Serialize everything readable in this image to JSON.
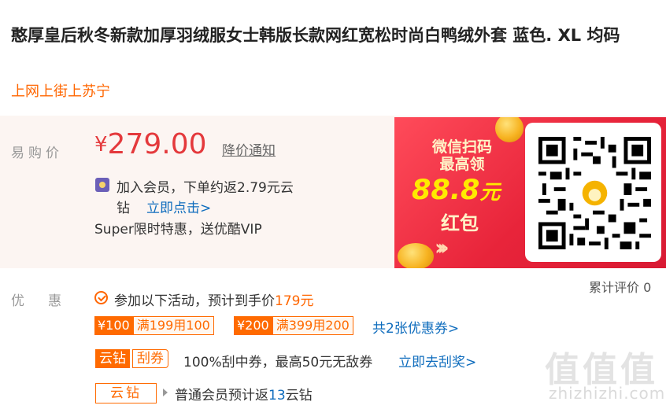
{
  "product": {
    "title": "憨厚皇后秋冬新款加厚羽绒服女士韩版长款网红宽松时尚白鸭绒外套 蓝色. XL 均码",
    "shop": "上网上街上苏宁"
  },
  "price": {
    "label": "易购价",
    "currency": "¥",
    "value": "279.00",
    "notice_link": "降价通知",
    "vip_line1": "加入会员，下单约返2.79元云",
    "vip_line2": "钻",
    "vip_link": "立即点击>",
    "super_text": "Super限时特惠，送优酷VIP"
  },
  "promo_banner": {
    "line1": "微信扫码",
    "line2": "最高领",
    "amount": "88.8",
    "amount_unit": "元",
    "red_packet": "红包",
    "arrows": "›››"
  },
  "discount": {
    "label": "优惠",
    "review_label": "累计评价 0",
    "activity_prefix": "参加以下活动，预计到手价",
    "activity_price": "179元",
    "coupons": [
      {
        "amount": "¥100",
        "condition": "满199用100"
      },
      {
        "amount": "¥200",
        "condition": "满399用200"
      }
    ],
    "coupon_link": "共2张优惠券>",
    "cloud_tag": "云钻",
    "scratch_tag": "刮券",
    "scratch_text": "100%刮中券，最高50元无敌券",
    "scratch_link": "立即去刮奖>",
    "cloud_tag2": "云钻",
    "return_prefix": "普通会员预计返",
    "return_num": "13",
    "return_suffix": "云钻"
  },
  "watermark": {
    "main": "值值值",
    "sub": "zhizhizhi.com"
  },
  "colors": {
    "price_red": "#e4393c",
    "accent_orange": "#ff6600",
    "link_blue": "#0e6cbd",
    "promo_red": "#e8243a"
  }
}
